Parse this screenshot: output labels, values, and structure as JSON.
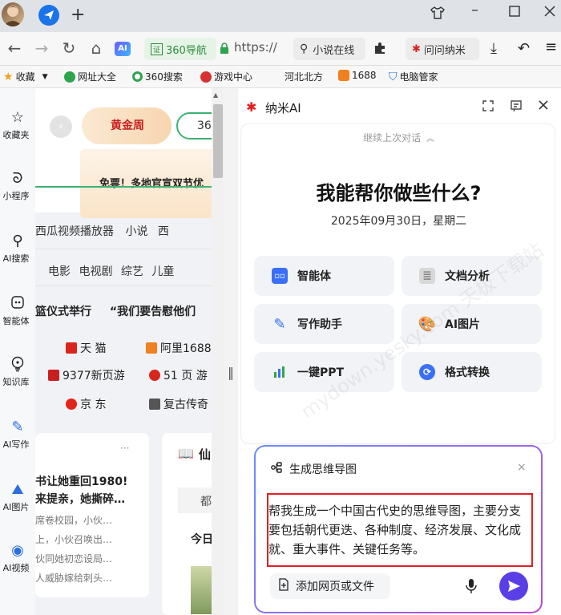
{
  "colors": {
    "accent": "#1a73e8",
    "panel_send": "#5b3fe6",
    "highlight_border": "#e02020",
    "link_green": "#2ea44f"
  },
  "tabbar": {
    "window_controls": [
      "shirt-icon",
      "minimize-icon",
      "maximize-icon",
      "close-icon"
    ]
  },
  "addressbar": {
    "nav_home_label": "360导航",
    "url": "https://",
    "search_text": "小说在线",
    "ai_button": "问问纳米"
  },
  "bookmarks": {
    "items": [
      "收藏",
      "网址大全",
      "360搜索",
      "游戏中心",
      "河北北方",
      "1688",
      "电脑管家"
    ]
  },
  "sidebar": {
    "items": [
      {
        "label": "收藏夹",
        "icon": "star-icon"
      },
      {
        "label": "小程序",
        "icon": "mini-program-icon"
      },
      {
        "label": "AI搜索",
        "icon": "search-icon"
      },
      {
        "label": "智能体",
        "icon": "agent-icon"
      },
      {
        "label": "知识库",
        "icon": "knowledge-icon"
      },
      {
        "label": "AI写作",
        "icon": "write-icon"
      },
      {
        "label": "AI图片",
        "icon": "image-icon"
      },
      {
        "label": "AI视频",
        "icon": "video-icon"
      }
    ]
  },
  "web": {
    "banner_tag": "黄金周",
    "banner_num": "36",
    "banner_text": "免票！多地官宣双节优",
    "quick_links": [
      "西瓜视频播放器",
      "小说",
      "西"
    ],
    "categories": [
      "电影",
      "电视剧",
      "综艺",
      "儿童"
    ],
    "headline_left": "篮仪式举行",
    "headline_right": "“我们要告慰他们",
    "sites": [
      [
        "天 猫",
        "阿里1688"
      ],
      [
        "9377新页游",
        "51 页 游"
      ],
      [
        "京 东",
        "复古传奇"
      ]
    ],
    "news": {
      "title_1": "书让她重回1980!",
      "title_2": "来提亲，她撕碎…",
      "lines": [
        "席卷校园，小伙…",
        "上，小伙召唤出…",
        "伙同她初恋设局…",
        "人威胁嫁给刺头…"
      ],
      "more": "···"
    },
    "right_card_title": "仙",
    "right_card_tab": "都",
    "right_card_sub": "今日"
  },
  "ai": {
    "title": "纳米AI",
    "continue_text": "继续上次对话",
    "heading": "我能帮你做些什么?",
    "date": "2025年09月30日，星期二",
    "features": [
      {
        "label": "智能体",
        "icon": "agent-icon",
        "color": "#3a6ff7"
      },
      {
        "label": "文档分析",
        "icon": "document-icon",
        "color": "#999999"
      },
      {
        "label": "写作助手",
        "icon": "pen-icon",
        "color": "#3a6ff7"
      },
      {
        "label": "AI图片",
        "icon": "palette-icon",
        "color": "#e0a030"
      },
      {
        "label": "一键PPT",
        "icon": "chart-icon",
        "color": "#2ea44f"
      },
      {
        "label": "格式转换",
        "icon": "convert-icon",
        "color": "#3a6ff7"
      }
    ],
    "input": {
      "mode_label": "生成思维导图",
      "prompt": "帮我生成一个中国古代史的思维导图，主要分支要包括朝代更迭、各种制度、经济发展、文化成就、重大事件、关键任务等。",
      "attach_label": "添加网页或文件"
    },
    "watermark": "mydown.yesky.com 天极下载站"
  }
}
